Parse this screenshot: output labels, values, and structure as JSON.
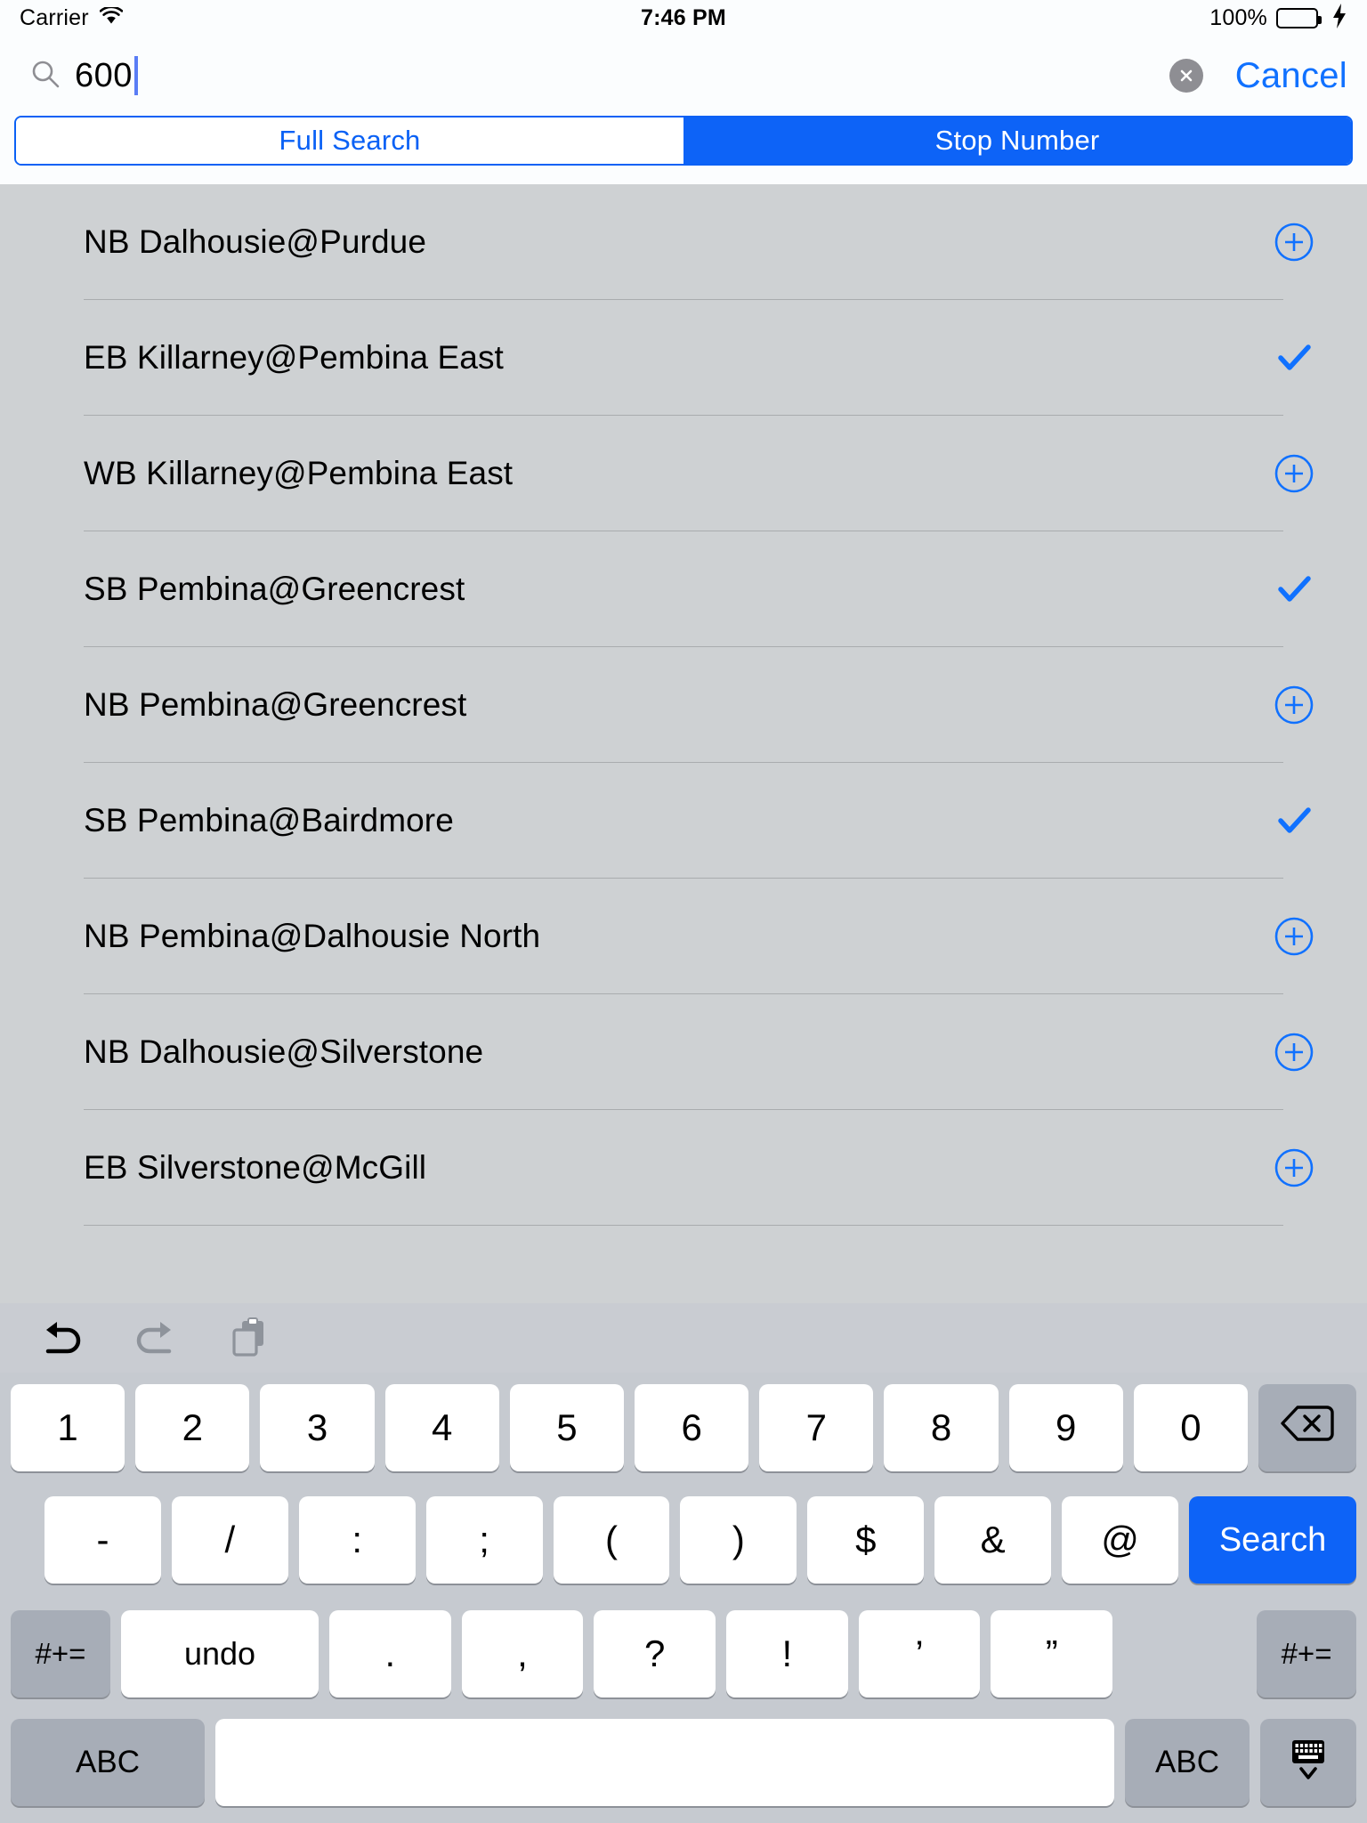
{
  "status_bar": {
    "carrier": "Carrier",
    "wifi_icon": "wifi-icon",
    "time": "7:46 PM",
    "battery_percent": "100%",
    "battery_icon": "battery-full-icon",
    "charging_icon": "lightning-bolt-icon",
    "battery_color": "#4CD964"
  },
  "search": {
    "icon": "search-magnifier-icon",
    "value": "600",
    "placeholder": "Search",
    "clear_icon": "clear-circle-x-icon",
    "cancel_label": "Cancel",
    "accent_color": "#1071FF"
  },
  "segmented_control": {
    "accent_color": "#0A61F5",
    "segments": [
      {
        "label": "Full Search",
        "selected": false
      },
      {
        "label": "Stop Number",
        "selected": true
      }
    ]
  },
  "list": {
    "background_color": "#CED1D3",
    "rows": [
      {
        "label": "NB Dalhousie@Purdue",
        "accessory": "add-circle-icon"
      },
      {
        "label": "EB Killarney@Pembina East",
        "accessory": "checkmark-icon"
      },
      {
        "label": "WB Killarney@Pembina East",
        "accessory": "add-circle-icon"
      },
      {
        "label": "SB Pembina@Greencrest",
        "accessory": "checkmark-icon"
      },
      {
        "label": "NB Pembina@Greencrest",
        "accessory": "add-circle-icon"
      },
      {
        "label": "SB Pembina@Bairdmore",
        "accessory": "checkmark-icon"
      },
      {
        "label": "NB Pembina@Dalhousie North",
        "accessory": "add-circle-icon"
      },
      {
        "label": "NB Dalhousie@Silverstone",
        "accessory": "add-circle-icon"
      },
      {
        "label": "EB Silverstone@McGill",
        "accessory": "add-circle-icon"
      }
    ]
  },
  "keyboard": {
    "background_color": "#C6CAD0",
    "toolbar": [
      {
        "name": "undo-icon",
        "enabled": true
      },
      {
        "name": "redo-icon",
        "enabled": false
      },
      {
        "name": "paste-clipboard-icon",
        "enabled": false
      }
    ],
    "row1": [
      "1",
      "2",
      "3",
      "4",
      "5",
      "6",
      "7",
      "8",
      "9",
      "0"
    ],
    "backspace_icon": "delete-backward-icon",
    "row2": [
      "-",
      "/",
      ":",
      ";",
      "(",
      ")",
      "$",
      "&",
      "@"
    ],
    "return_key_label": "Search",
    "row3_left_mod": "#+=",
    "row3": [
      "undo",
      ".",
      ",",
      "?",
      "!",
      "’",
      "”"
    ],
    "row3_right_mod": "#+=",
    "bottom": {
      "left_abc": "ABC",
      "space": "",
      "right_abc": "ABC",
      "dismiss_icon": "hide-keyboard-icon"
    }
  }
}
